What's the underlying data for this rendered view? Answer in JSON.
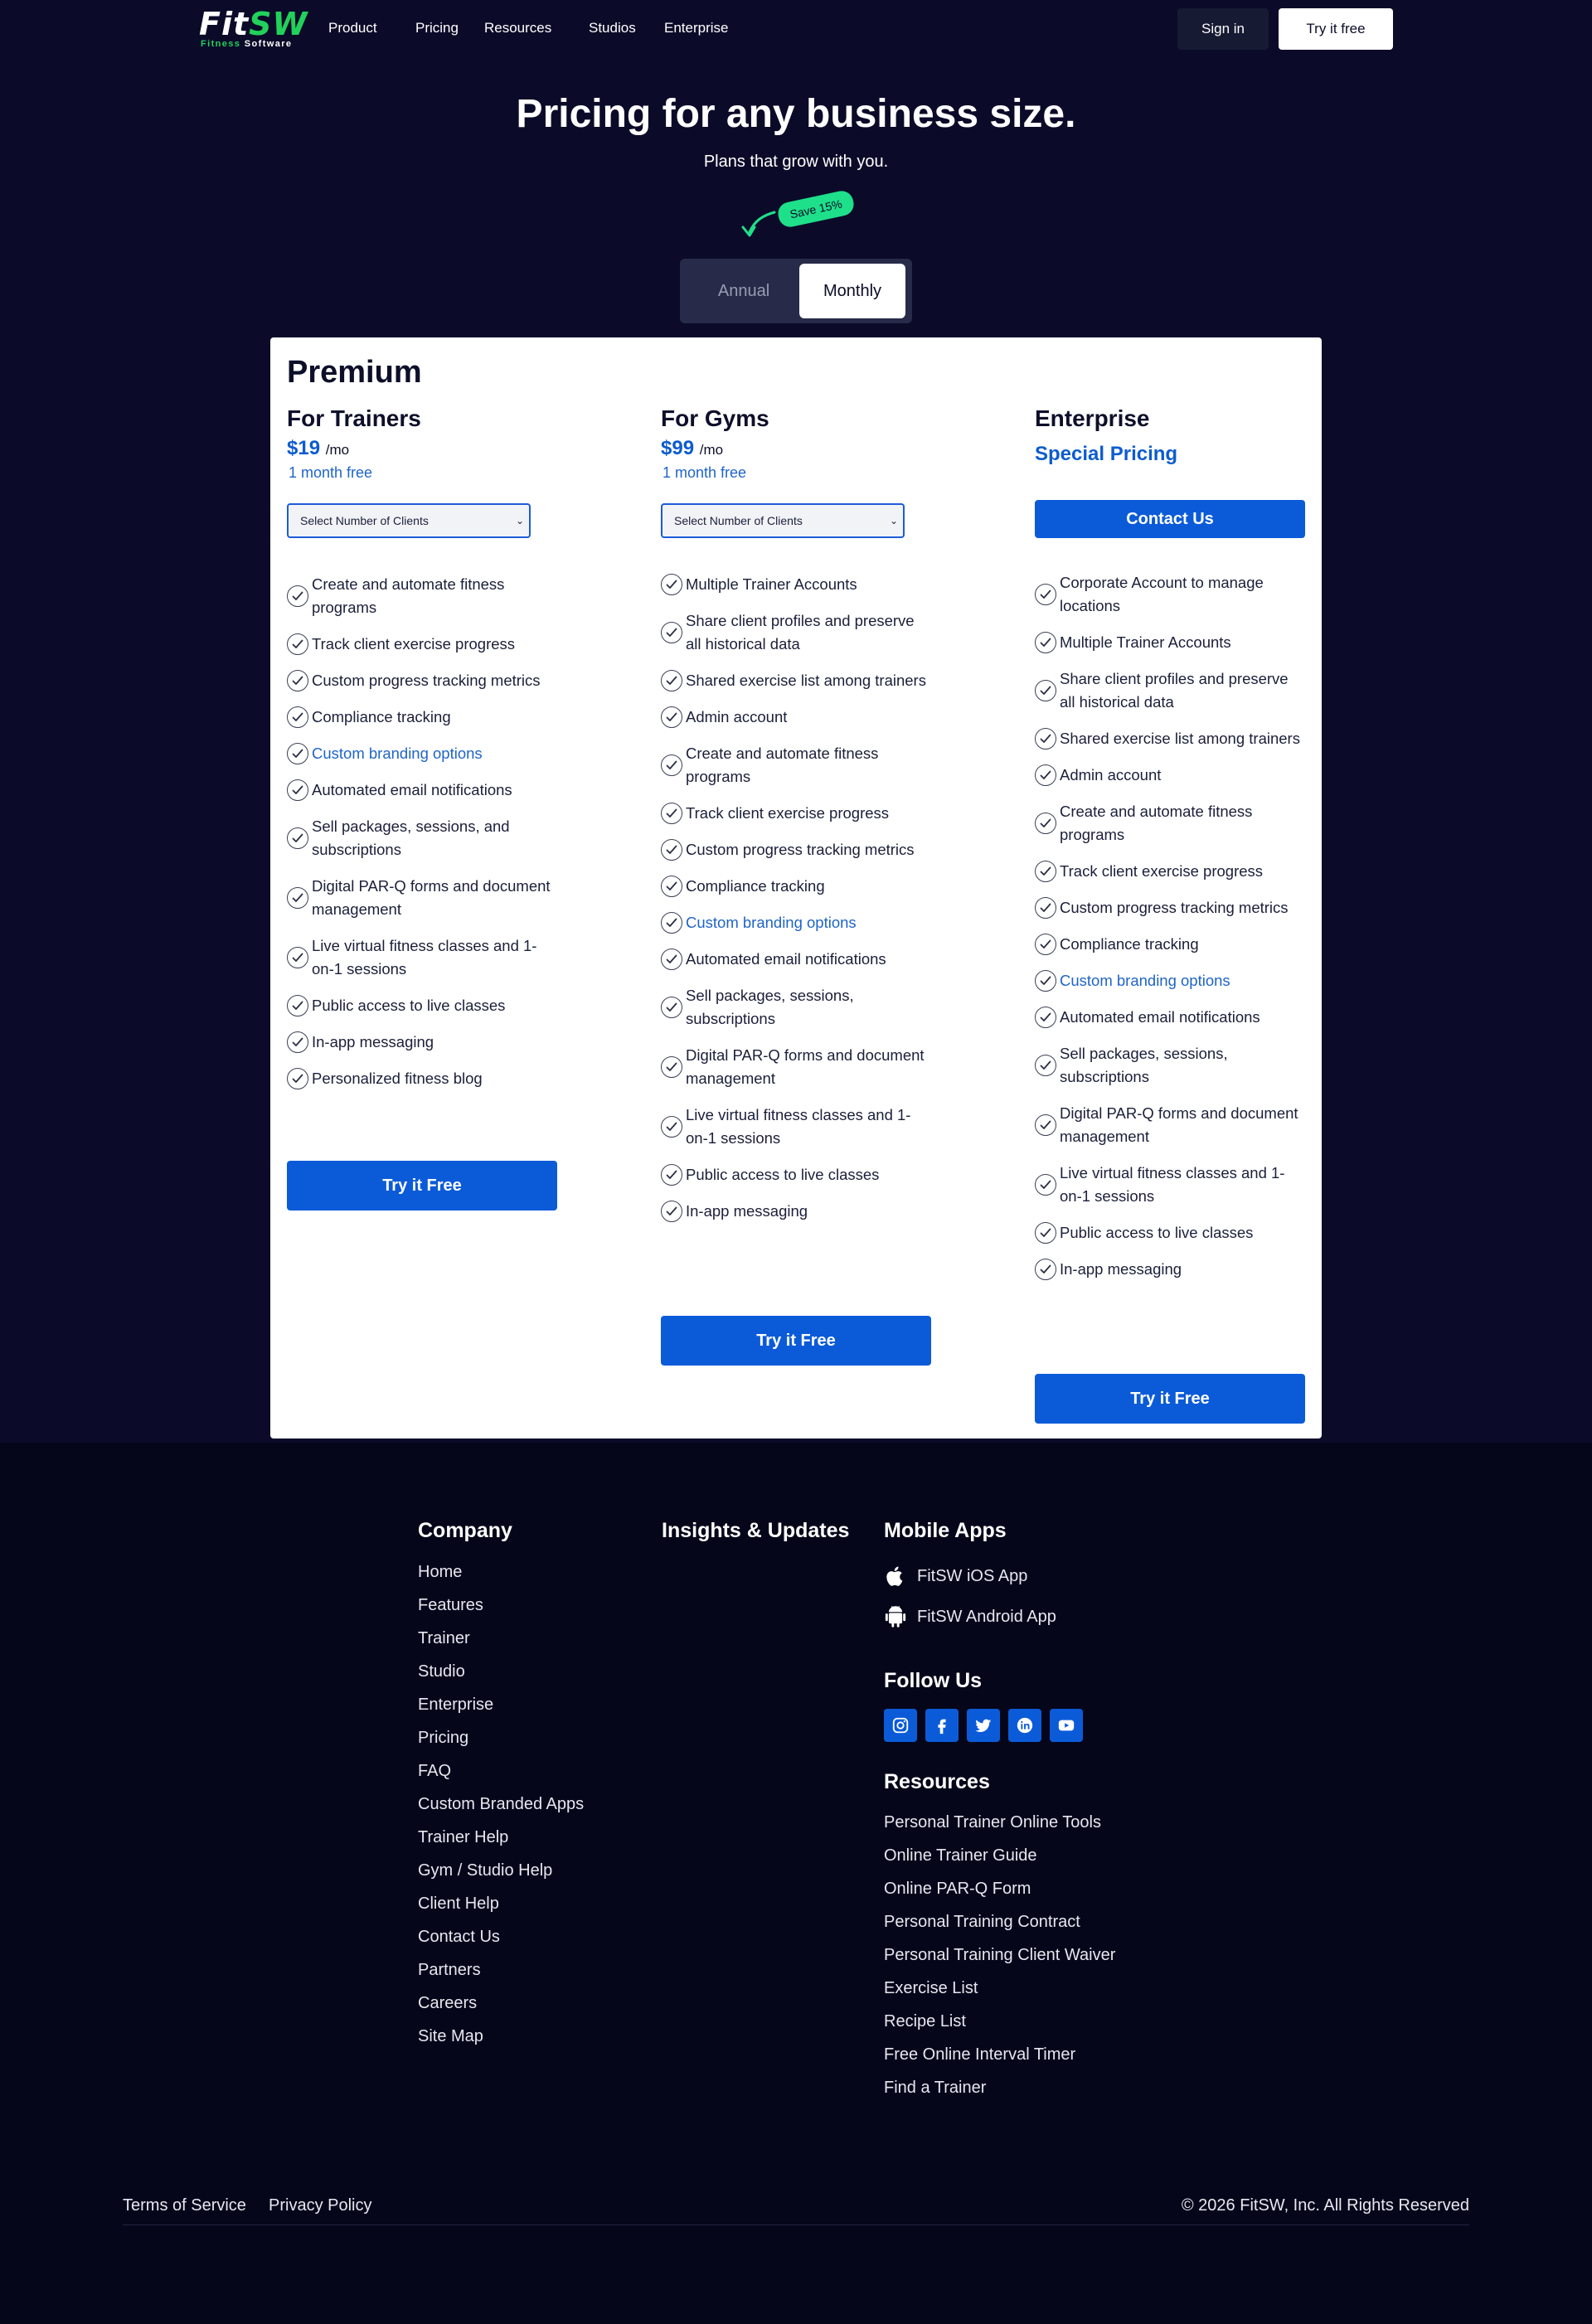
{
  "nav": {
    "logo_main_fit": "Fit",
    "logo_main_sw": "SW",
    "logo_sub_a": "Fitness ",
    "logo_sub_b": "Software",
    "links": [
      "Product",
      "Pricing",
      "Resources",
      "Studios",
      "Enterprise"
    ],
    "signin": "Sign in",
    "try_free": "Try it free"
  },
  "hero": {
    "title": "Pricing for any business size.",
    "subtitle": "Plans that grow with you.",
    "save_badge": "Save 15%",
    "toggle_annual": "Annual",
    "toggle_monthly": "Monthly"
  },
  "card": {
    "title": "Premium",
    "trainers": {
      "title": "For Trainers",
      "price": "$19",
      "per": "/mo",
      "free": "1 month free",
      "select_label": "Select Number of Clients",
      "features": [
        "Create and automate fitness programs",
        "Track client exercise progress",
        "Custom progress tracking metrics",
        "Compliance tracking",
        "Custom branding options",
        "Automated email notifications",
        "Sell packages, sessions, and subscriptions",
        "Digital PAR-Q forms and document management",
        "Live virtual fitness classes and 1-on-1 sessions",
        "Public access to live classes",
        "In-app messaging",
        "Personalized fitness blog"
      ],
      "cta": "Try it Free"
    },
    "gyms": {
      "title": "For Gyms",
      "price": "$99",
      "per": "/mo",
      "free": "1 month free",
      "select_label": "Select Number of Clients",
      "features": [
        "Multiple Trainer Accounts",
        "Share client profiles and preserve all historical data",
        "Shared exercise list among trainers",
        "Admin account",
        "Create and automate fitness programs",
        "Track client exercise progress",
        "Custom progress tracking metrics",
        "Compliance tracking",
        "Custom branding options",
        "Automated email notifications",
        "Sell packages, sessions, subscriptions",
        "Digital PAR-Q forms and document management",
        "Live virtual fitness classes and 1-on-1 sessions",
        "Public access to live classes",
        "In-app messaging"
      ],
      "cta": "Try it Free"
    },
    "enterprise": {
      "title": "Enterprise",
      "special": "Special Pricing",
      "contact": "Contact Us",
      "features": [
        "Corporate Account to manage locations",
        "Multiple Trainer Accounts",
        "Share client profiles and preserve all historical data",
        "Shared exercise list among trainers",
        "Admin account",
        "Create and automate fitness programs",
        "Track client exercise progress",
        "Custom progress tracking metrics",
        "Compliance tracking",
        "Custom branding options",
        "Automated email notifications",
        "Sell packages, sessions, subscriptions",
        "Digital PAR-Q forms and document management",
        "Live virtual fitness classes and 1-on-1 sessions",
        "Public access to live classes",
        "In-app messaging"
      ],
      "cta": "Try it Free"
    }
  },
  "footer": {
    "company_head": "Company",
    "company_links": [
      "Home",
      "Features",
      "Trainer",
      "Studio",
      "Enterprise",
      "Pricing",
      "FAQ",
      "Custom Branded Apps",
      "Trainer Help",
      "Gym / Studio Help",
      "Client Help",
      "Contact Us",
      "Partners",
      "Careers",
      "Site Map"
    ],
    "insights_head": "Insights & Updates",
    "mobile_head": "Mobile Apps",
    "ios_app": "FitSW iOS App",
    "android_app": "FitSW Android App",
    "follow_head": "Follow Us",
    "resources_head": "Resources",
    "resources_links": [
      "Personal Trainer Online Tools",
      "Online Trainer Guide",
      "Online PAR-Q Form",
      "Personal Training Contract",
      "Personal Training Client Waiver",
      "Exercise List",
      "Recipe List",
      "Free Online Interval Timer",
      "Find a Trainer"
    ],
    "terms": "Terms of Service",
    "privacy": "Privacy Policy",
    "copyright": "© 2026 FitSW, Inc. All Rights Reserved"
  },
  "colors": {
    "background": "#0b0b29",
    "accent_blue": "#0b5bd9",
    "brand_green": "#22d15a",
    "save_green": "#1ee08a"
  },
  "icons": [
    "check-icon",
    "chevron-down-icon",
    "apple-icon",
    "android-icon",
    "instagram-icon",
    "facebook-icon",
    "twitter-icon",
    "linkedin-icon",
    "youtube-icon",
    "curved-arrow-icon"
  ]
}
